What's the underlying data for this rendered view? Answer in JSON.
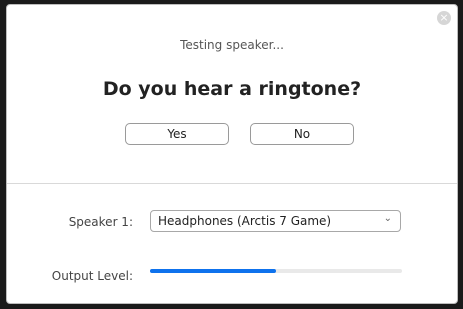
{
  "dialog": {
    "status_text": "Testing speaker...",
    "question": "Do you hear a ringtone?",
    "yes_label": "Yes",
    "no_label": "No",
    "close_icon": "close-icon"
  },
  "speaker": {
    "label": "Speaker 1:",
    "selected": "Headphones (Arctis 7 Game)",
    "chevron_icon": "chevron-down-icon"
  },
  "output": {
    "label": "Output Level:",
    "level_percent": 50,
    "color": "#0e72ed"
  }
}
